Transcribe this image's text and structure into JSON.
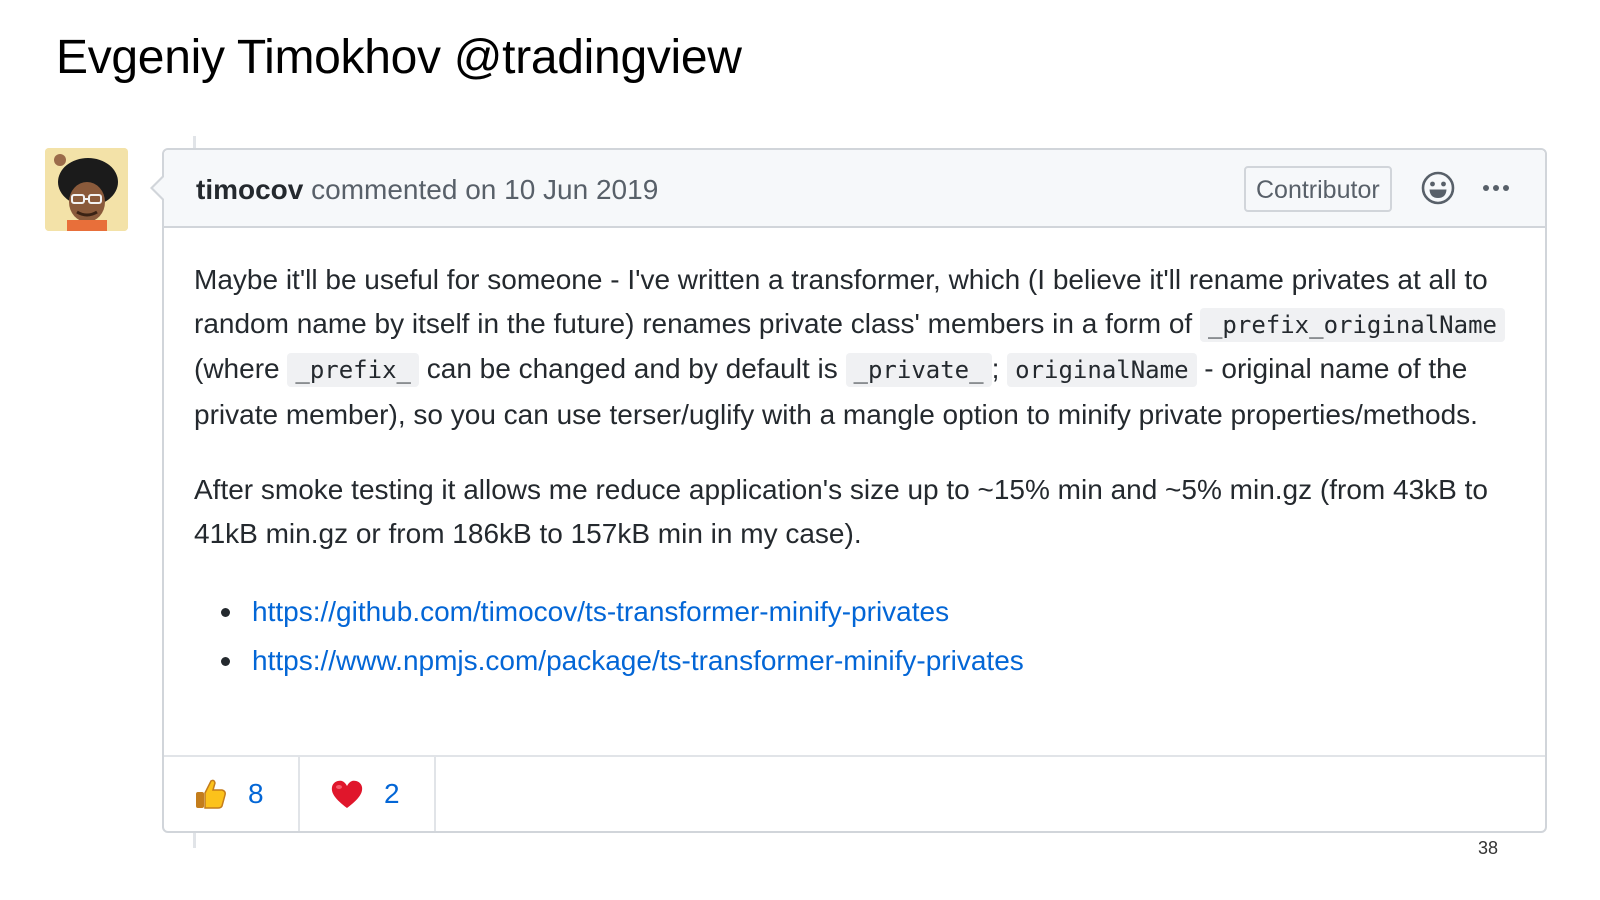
{
  "slide": {
    "title": "Evgeniy Timokhov @tradingview"
  },
  "comment": {
    "author": "timocov",
    "meta": "commented on 10 Jun 2019",
    "badge": "Contributor",
    "icons": {
      "reaction": "smiley-icon",
      "more": "kebab-horizontal-icon"
    },
    "paragraph1": [
      {
        "type": "text",
        "text": "Maybe it'll be useful for someone - I've written a transformer, which (I believe it'll rename privates at all to random name by itself in the future) renames private class' members in a form of "
      },
      {
        "type": "code",
        "text": "_prefix_originalName"
      },
      {
        "type": "text",
        "text": " (where "
      },
      {
        "type": "code",
        "text": "_prefix_"
      },
      {
        "type": "text",
        "text": " can be changed and by default is "
      },
      {
        "type": "code",
        "text": "_private_"
      },
      {
        "type": "text",
        "text": "; "
      },
      {
        "type": "code",
        "text": "originalName"
      },
      {
        "type": "text",
        "text": " - original name of the private member), so you can use terser/uglify with a mangle option to minify private properties/methods."
      }
    ],
    "paragraph2": "After smoke testing it allows me reduce application's size up to ~15% min and ~5% min.gz (from 43kB to 41kB min.gz or from 186kB to 157kB min in my case).",
    "links": [
      "https://github.com/timocov/ts-transformer-minify-privates",
      "https://www.npmjs.com/package/ts-transformer-minify-privates"
    ],
    "reactions": [
      {
        "icon": "thumbs-up-icon",
        "count": "8"
      },
      {
        "icon": "heart-icon",
        "count": "2"
      }
    ]
  },
  "colors": {
    "link": "#0366d6",
    "border": "#d1d5da",
    "header_bg": "#f6f8fa",
    "text": "#24292e",
    "muted": "#586069"
  },
  "page_number": "38"
}
